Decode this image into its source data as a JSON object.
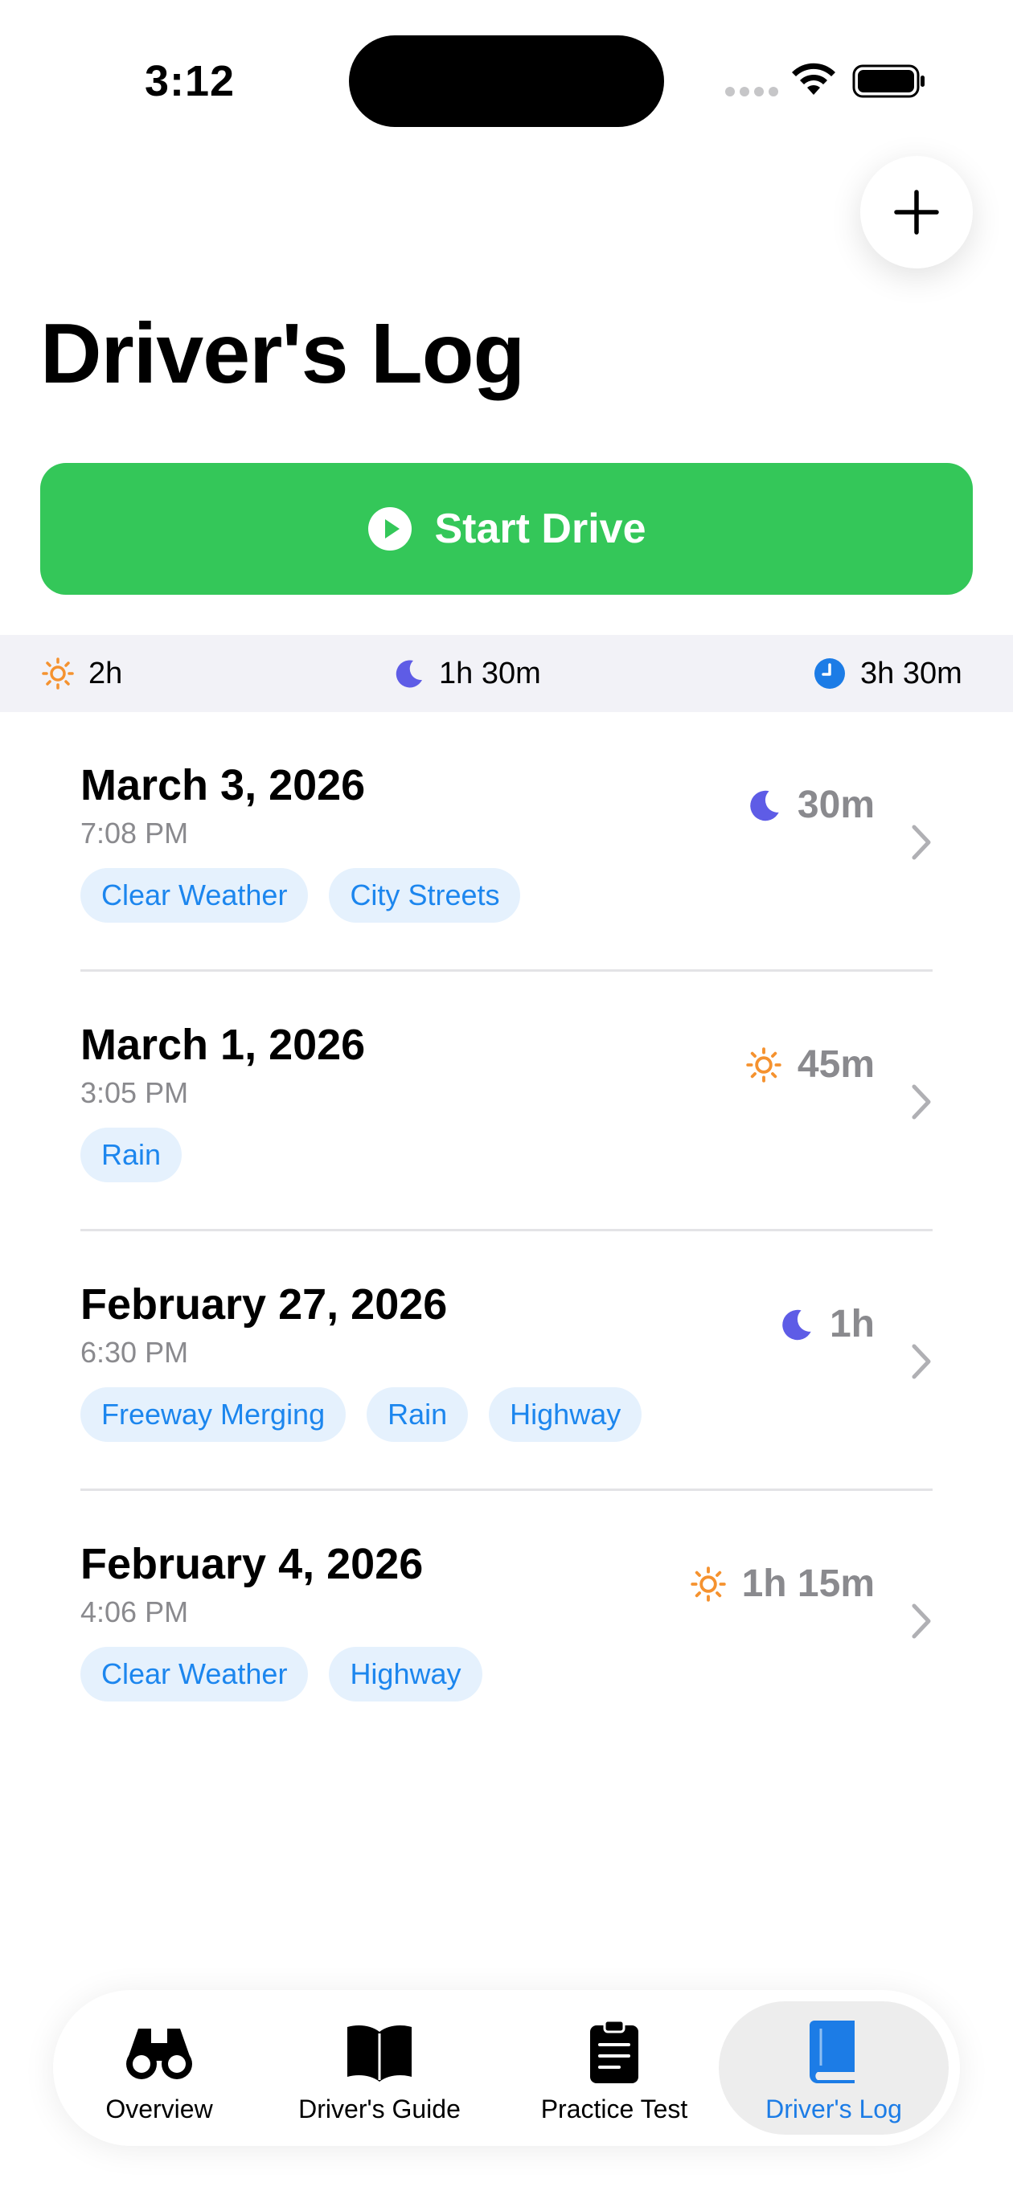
{
  "status_bar": {
    "time": "3:12"
  },
  "header": {
    "title": "Driver's Log",
    "add_icon": "plus-icon"
  },
  "start_drive": {
    "label": "Start Drive",
    "icon": "play-circle-icon",
    "color": "#34c759"
  },
  "summary": {
    "day": {
      "icon": "sun-icon",
      "value": "2h"
    },
    "night": {
      "icon": "moon-icon",
      "value": "1h 30m"
    },
    "total": {
      "icon": "clock-icon",
      "value": "3h 30m"
    }
  },
  "drives": [
    {
      "date": "March 3, 2026",
      "time": "7:08 PM",
      "period": "night",
      "duration": "30m",
      "tags": [
        "Clear Weather",
        "City Streets"
      ]
    },
    {
      "date": "March 1, 2026",
      "time": "3:05 PM",
      "period": "day",
      "duration": "45m",
      "tags": [
        "Rain"
      ]
    },
    {
      "date": "February 27, 2026",
      "time": "6:30 PM",
      "period": "night",
      "duration": "1h",
      "tags": [
        "Freeway Merging",
        "Rain",
        "Highway"
      ]
    },
    {
      "date": "February 4, 2026",
      "time": "4:06 PM",
      "period": "day",
      "duration": "1h 15m",
      "tags": [
        "Clear Weather",
        "Highway"
      ]
    }
  ],
  "tab_bar": {
    "items": [
      {
        "label": "Overview",
        "icon": "binoculars-icon"
      },
      {
        "label": "Driver's Guide",
        "icon": "book-open-icon"
      },
      {
        "label": "Practice Test",
        "icon": "clipboard-icon"
      },
      {
        "label": "Driver's Log",
        "icon": "book-closed-icon",
        "active": true
      }
    ]
  },
  "colors": {
    "accent": "#1c7ce6",
    "sun": "#f5922f",
    "moon": "#5e5ce6",
    "tag_bg": "#e5f1fd",
    "tag_text": "#1c86ee"
  }
}
